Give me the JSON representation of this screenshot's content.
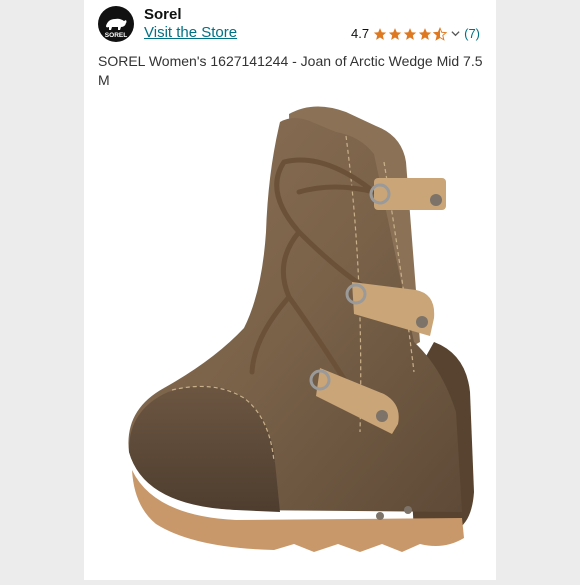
{
  "brand": {
    "name": "Sorel",
    "logo_text": "SOREL",
    "store_link": "Visit the Store"
  },
  "rating": {
    "value": "4.7",
    "stars_filled": 4.5,
    "stars_total": 5,
    "count": "(7)"
  },
  "product": {
    "title": "SOREL Women's 1627141244 - Joan of Arctic Wedge Mid 7.5 M"
  },
  "colors": {
    "link": "#007185",
    "star": "#de7921",
    "leather": "#7a6249",
    "strap": "#c9a578",
    "sole": "#c9986a"
  },
  "icons": {
    "logo": "polar-bear-icon",
    "star": "star-icon"
  }
}
